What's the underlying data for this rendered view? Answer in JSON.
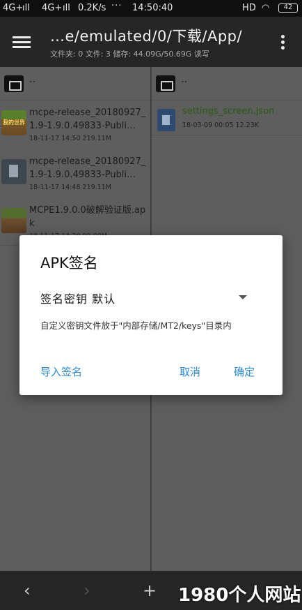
{
  "status_bar": {
    "signal_1": "4G+",
    "signal_2": "4G+",
    "network_speed": "0.2K/s",
    "more": "···",
    "time": "14:50:40",
    "hd": "HD",
    "battery": "42"
  },
  "toolbar": {
    "path": "…e/emulated/0/下载/App/",
    "info": "文件夹: 0  文件: 3  储存: 44.09G/50.69G  读写"
  },
  "left_pane": {
    "parent": "..",
    "files": [
      {
        "name": "mcpe-release_20180927_1.9-1.9.0.49833-Publi…",
        "meta": "18-11-17 14:50  219.11M",
        "thumb_label": "我的世界"
      },
      {
        "name": "mcpe-release_20180927_1.9-1.9.0.49833-Publi…",
        "meta": "18-11-17 14:48  219.11M"
      },
      {
        "name": "MCPE1.9.0.0破解验证版.apk",
        "meta": "18-11-17 14:20  90.00M"
      }
    ]
  },
  "right_pane": {
    "parent": "..",
    "files": [
      {
        "name": "settings_screen.json",
        "meta": "18-03-09 00:05  12.23K"
      }
    ]
  },
  "dialog": {
    "title": "APK签名",
    "key_label": "签名密钥  默认",
    "description": "自定义密钥文件放于\"内部存储/MT2/keys\"目录内",
    "import_label": "导入签名",
    "cancel_label": "取消",
    "ok_label": "确定"
  },
  "bottom_bar": {
    "back": "‹",
    "forward": "›",
    "add": "+"
  },
  "watermark": "1980个人网站"
}
